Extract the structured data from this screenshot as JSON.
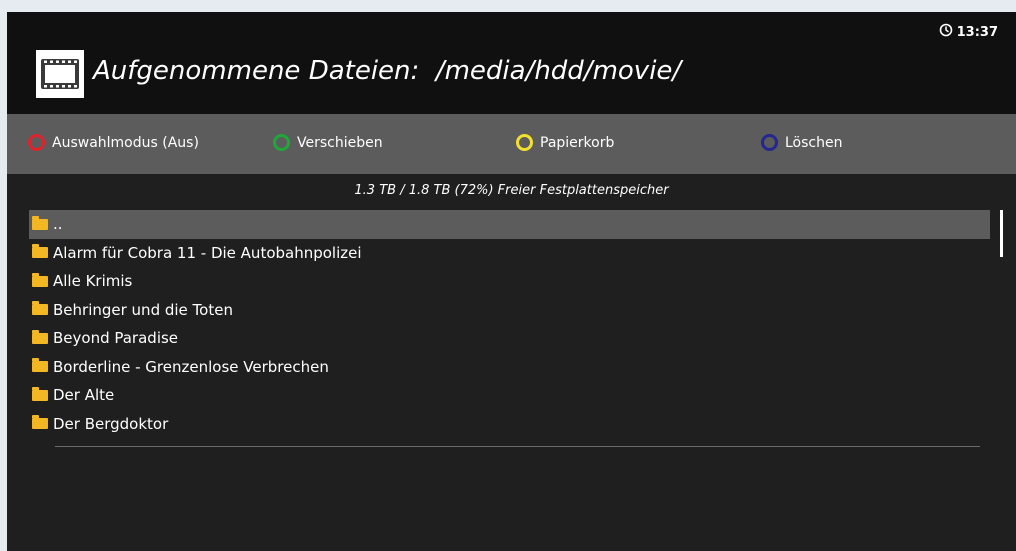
{
  "header": {
    "title": "Aufgenommene Dateien:  /media/hdd/movie/",
    "clock": "13:37"
  },
  "buttons": {
    "red": "Auswahlmodus (Aus)",
    "green": "Verschieben",
    "yellow": "Papierkorb",
    "blue": "Löschen"
  },
  "disk_info": "1.3 TB / 1.8 TB (72%) Freier Festplattenspeicher",
  "list": {
    "items": [
      "..",
      "Alarm für Cobra 11 - Die Autobahnpolizei",
      "Alle Krimis",
      "Behringer und die Toten",
      "Beyond Paradise",
      "Borderline - Grenzenlose Verbrechen",
      "Der Alte",
      "Der Bergdoktor"
    ],
    "selected_index": 0
  },
  "colors": {
    "red": "#e0232b",
    "green": "#1fa83a",
    "yellow": "#f3e02c",
    "blue": "#23278f",
    "folder": "#f3b723"
  }
}
